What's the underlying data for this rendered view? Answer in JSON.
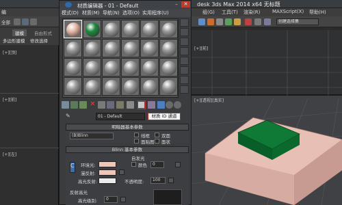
{
  "max_window": {
    "title": "desk 3ds Max  2014 x64     无标题",
    "menu": [
      "组(G)",
      "工具(T)",
      "渲染(R)",
      "MAXScript(X)",
      "帮助(H)"
    ],
    "selection_set_placeholder": "创建选择集",
    "ribbon": {
      "tabs": [
        "建模",
        "自由形式"
      ],
      "row2": "多边形建模",
      "row3": "修改选择"
    },
    "viewport_left_labels": [
      "[+][顶]",
      "[+][前]",
      "[+][左]"
    ],
    "viewport_right_top_label": "[+][前]",
    "viewport_right_bottom_label": "[+][透视][真实]",
    "left_edge_labels": [
      "编",
      "全部"
    ]
  },
  "material_editor": {
    "title": "材质编辑器 - 01 - Default",
    "menu": [
      "模式(D)",
      "材质(M)",
      "导航(N)",
      "选项(O)",
      "实用程序(U)"
    ],
    "slots": [
      {
        "color": "#e6b8a6",
        "selected": true
      },
      {
        "color": "#1f8a3d",
        "selected": false
      },
      {
        "color": "#9a9a9a"
      },
      {
        "color": "#9a9a9a"
      },
      {
        "color": "#9a9a9a"
      },
      {
        "color": "#9a9a9a"
      },
      {
        "color": "#9a9a9a"
      },
      {
        "color": "#9a9a9a"
      },
      {
        "color": "#9a9a9a"
      },
      {
        "color": "#9a9a9a"
      },
      {
        "color": "#9a9a9a"
      },
      {
        "color": "#9a9a9a"
      },
      {
        "color": "#9a9a9a"
      },
      {
        "color": "#9a9a9a"
      },
      {
        "color": "#9a9a9a"
      },
      {
        "color": "#9a9a9a"
      },
      {
        "color": "#9a9a9a"
      },
      {
        "color": "#9a9a9a"
      },
      {
        "color": "#9a9a9a"
      },
      {
        "color": "#9a9a9a"
      },
      {
        "color": "#9a9a9a"
      },
      {
        "color": "#9a9a9a"
      },
      {
        "color": "#9a9a9a"
      },
      {
        "color": "#9a9a9a"
      }
    ],
    "material_name": "01 - Default",
    "tooltip": "材质 ID 通道",
    "shader_rollout": {
      "header": "明暗器基本参数",
      "shader": "(B)Blinn",
      "options": [
        "线框",
        "双面",
        "面贴图",
        "面状"
      ]
    },
    "blinn_rollout": {
      "header": "Blinn 基本参数",
      "self_illum_group": "自发光",
      "color_label": "颜色",
      "color_value": "0",
      "ambient_label": "环境光:",
      "diffuse_label": "漫反射:",
      "specular_label": "高光反射:",
      "opacity_label": "不透明度:",
      "opacity_value": "100",
      "lock_letter": "C",
      "specular_highlights": "反射高光",
      "specular_level_label": "高光级别:",
      "specular_level_value": "0"
    }
  },
  "colors": {
    "slot_selected_sphere": "#e6b8a6",
    "green_material": "#1f8a3d",
    "highlight_red": "#e02020",
    "box_pink": "#e8bfb5"
  }
}
